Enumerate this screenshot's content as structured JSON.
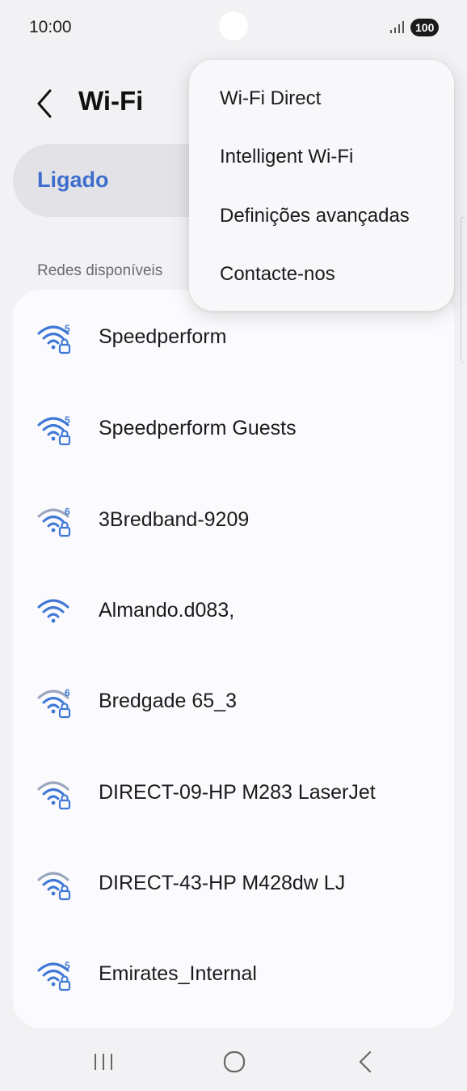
{
  "status_bar": {
    "time": "10:00",
    "battery": "100",
    "signal_icon": "signal-bars-icon"
  },
  "header": {
    "title": "Wi-Fi",
    "back_icon": "chevron-left-icon"
  },
  "toggle": {
    "label": "Ligado"
  },
  "available_networks": {
    "section_label": "Redes disponíveis",
    "items": [
      {
        "name": "Speedperform",
        "icon": "wifi-5-lock-icon"
      },
      {
        "name": "Speedperform Guests",
        "icon": "wifi-5-lock-icon"
      },
      {
        "name": "3Bredband-9209",
        "icon": "wifi-6-lock-icon"
      },
      {
        "name": "Almando.d083,",
        "icon": "wifi-open-icon"
      },
      {
        "name": "Bredgade 65_3",
        "icon": "wifi-6-lock-icon"
      },
      {
        "name": "DIRECT-09-HP M283 LaserJet",
        "icon": "wifi-lock-icon"
      },
      {
        "name": "DIRECT-43-HP M428dw LJ",
        "icon": "wifi-lock-icon"
      },
      {
        "name": "Emirates_Internal",
        "icon": "wifi-5-lock-icon"
      }
    ]
  },
  "overflow_menu": {
    "items": [
      {
        "label": "Wi-Fi Direct"
      },
      {
        "label": "Intelligent Wi-Fi"
      },
      {
        "label": "Definições avançadas"
      },
      {
        "label": "Contacte-nos"
      }
    ]
  },
  "nav_bar": {
    "recents_icon": "recents-icon",
    "home_icon": "home-icon",
    "back_icon": "nav-back-icon"
  },
  "colors": {
    "accent": "#3e6ecc",
    "wifi_icon": "#3f78d6",
    "background": "#f2f2f4",
    "card": "#fbfbfd"
  }
}
